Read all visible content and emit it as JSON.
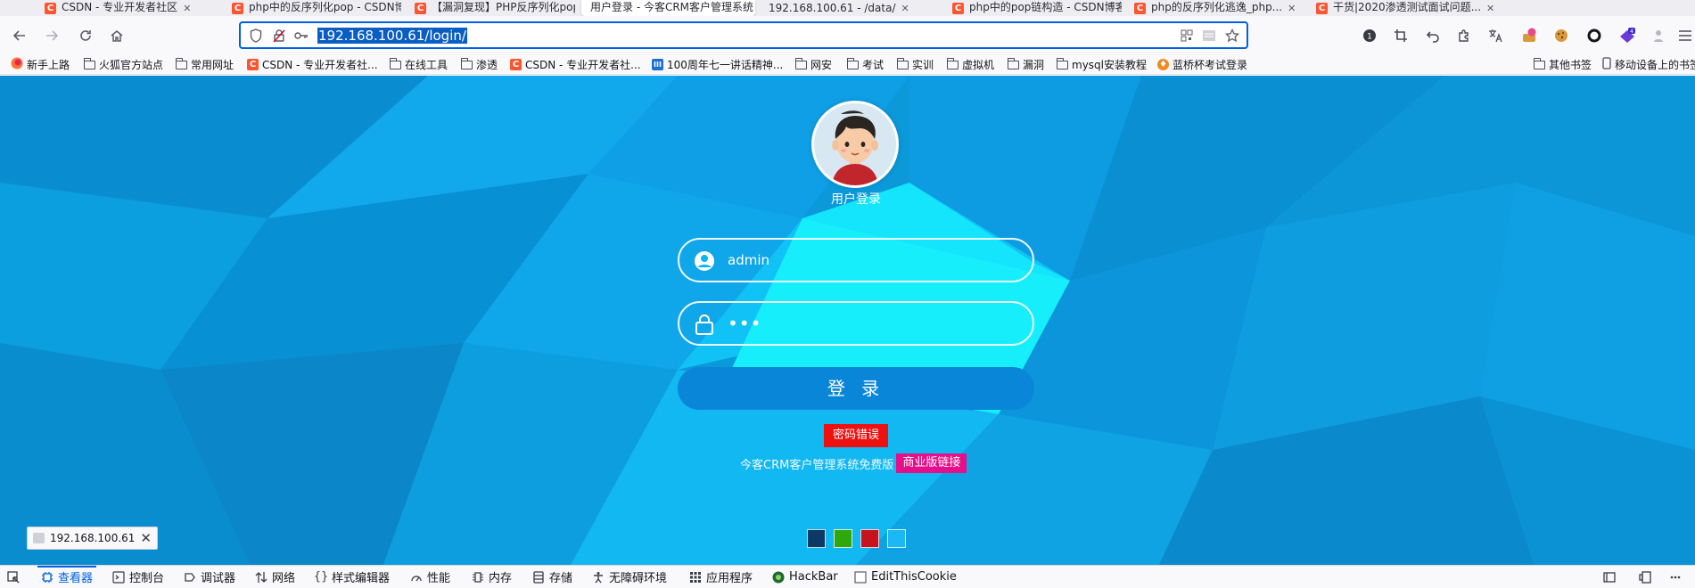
{
  "tabs": [
    {
      "label": "CSDN - 专业开发者社区"
    },
    {
      "label": "php中的反序列化pop - CSDN博客"
    },
    {
      "label": "【漏洞复现】PHP反序列化pop..."
    },
    {
      "label": "用户登录 - 今客CRM客户管理系统"
    },
    {
      "label": "192.168.100.61 - /data/"
    },
    {
      "label": "php中的pop链构造 - CSDN博客"
    },
    {
      "label": "php的反序列化逃逸_php..."
    },
    {
      "label": "干货|2020渗透测试面试问题..."
    }
  ],
  "urlbar": {
    "url": "192.168.100.61/login/"
  },
  "bookmarks": [
    {
      "label": "新手上路",
      "icon": "firefox-icon"
    },
    {
      "label": "火狐官方站点",
      "icon": "folder-icon"
    },
    {
      "label": "常用网址",
      "icon": "folder-icon"
    },
    {
      "label": "CSDN - 专业开发者社...",
      "icon": "csdn-icon"
    },
    {
      "label": "在线工具",
      "icon": "folder-icon"
    },
    {
      "label": "渗透",
      "icon": "folder-icon"
    },
    {
      "label": "CSDN - 专业开发者社...",
      "icon": "csdn-icon"
    },
    {
      "label": "100周年七一讲话精神...",
      "icon": "site-icon"
    },
    {
      "label": "网安",
      "icon": "folder-icon"
    },
    {
      "label": "考试",
      "icon": "folder-icon"
    },
    {
      "label": "实训",
      "icon": "folder-icon"
    },
    {
      "label": "虚拟机",
      "icon": "folder-icon"
    },
    {
      "label": "漏洞",
      "icon": "folder-icon"
    },
    {
      "label": "mysql安装教程",
      "icon": "folder-icon"
    },
    {
      "label": "蓝桥杯考试登录",
      "icon": "lanqiao-icon"
    }
  ],
  "bookmarks_right": [
    {
      "label": "其他书签"
    },
    {
      "label": "移动设备上的书签"
    }
  ],
  "login": {
    "caption": "用户登录",
    "username": "admin",
    "password_mask": "•••",
    "button": "登 录",
    "error": "密码错误",
    "promo_text": "今客CRM客户管理系统免费版",
    "promo_link": "商业版链接"
  },
  "theme_swatches": [
    "#0b3a66",
    "#2ea80c",
    "#c5141d",
    "#1bb8f5"
  ],
  "status": {
    "host": "192.168.100.61"
  },
  "devtools": [
    {
      "label": "查看器",
      "icon": "inspector-icon"
    },
    {
      "label": "控制台",
      "icon": "console-icon"
    },
    {
      "label": "调试器",
      "icon": "debugger-icon"
    },
    {
      "label": "网络",
      "icon": "network-icon"
    },
    {
      "label": "样式编辑器",
      "icon": "style-editor-icon"
    },
    {
      "label": "性能",
      "icon": "performance-icon"
    },
    {
      "label": "内存",
      "icon": "memory-icon"
    },
    {
      "label": "存储",
      "icon": "storage-icon"
    },
    {
      "label": "无障碍环境",
      "icon": "accessibility-icon"
    },
    {
      "label": "应用程序",
      "icon": "application-icon"
    },
    {
      "label": "HackBar",
      "icon": "hackbar-icon"
    },
    {
      "label": "EditThisCookie",
      "icon": "editthiscookie-icon"
    }
  ]
}
